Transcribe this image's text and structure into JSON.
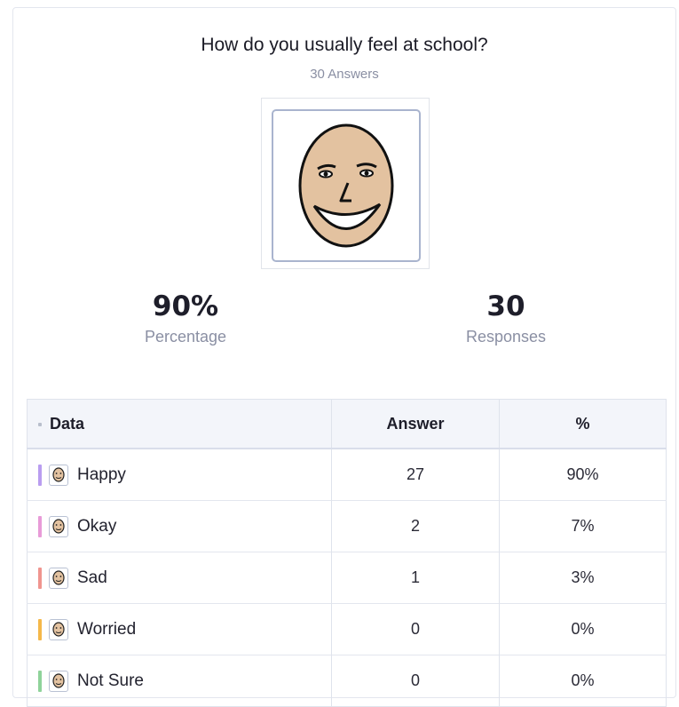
{
  "question": {
    "title": "How do you usually feel at school?",
    "answers_count": "30 Answers"
  },
  "stats": {
    "percentage_value": "90%",
    "percentage_label": "Percentage",
    "responses_value": "30",
    "responses_label": "Responses"
  },
  "table": {
    "headers": {
      "data": "Data",
      "answer": "Answer",
      "percent": "%"
    },
    "rows": [
      {
        "label": "Happy",
        "answer": "27",
        "percent": "90%",
        "color": "#b99df0",
        "icon": "happy-face-icon"
      },
      {
        "label": "Okay",
        "answer": "2",
        "percent": "7%",
        "color": "#e89bd8",
        "icon": "okay-face-icon"
      },
      {
        "label": "Sad",
        "answer": "1",
        "percent": "3%",
        "color": "#f0958f",
        "icon": "sad-face-icon"
      },
      {
        "label": "Worried",
        "answer": "0",
        "percent": "0%",
        "color": "#f5b84a",
        "icon": "worried-face-icon"
      },
      {
        "label": "Not Sure",
        "answer": "0",
        "percent": "0%",
        "color": "#8fd39a",
        "icon": "not-sure-face-icon"
      }
    ]
  },
  "colors": {
    "face_skin": "#e3c2a0",
    "subtle_text": "#8a8fa3"
  }
}
